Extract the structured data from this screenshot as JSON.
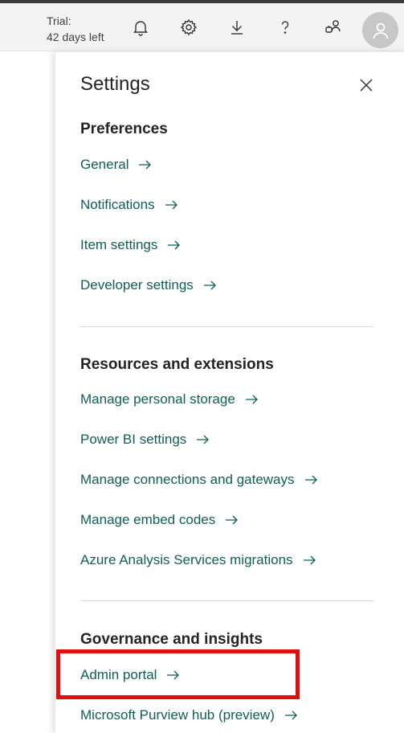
{
  "topbar": {
    "trial_line1": "Trial:",
    "trial_line2": "42 days left",
    "icons": [
      "bell-icon",
      "gear-icon",
      "download-icon",
      "help-icon",
      "share-icon",
      "avatar"
    ]
  },
  "settings": {
    "title": "Settings",
    "preferences": {
      "heading": "Preferences",
      "links": [
        "General",
        "Notifications",
        "Item settings",
        "Developer settings"
      ]
    },
    "resources": {
      "heading": "Resources and extensions",
      "links": [
        "Manage personal storage",
        "Power BI settings",
        "Manage connections and gateways",
        "Manage embed codes",
        "Azure Analysis Services migrations"
      ]
    },
    "governance": {
      "heading": "Governance and insights",
      "links": [
        "Admin portal",
        "Microsoft Purview hub (preview)"
      ]
    }
  },
  "colors": {
    "link": "#0f5f56",
    "highlight": "#e01010",
    "topbar_bg": "#f3f3f3"
  }
}
